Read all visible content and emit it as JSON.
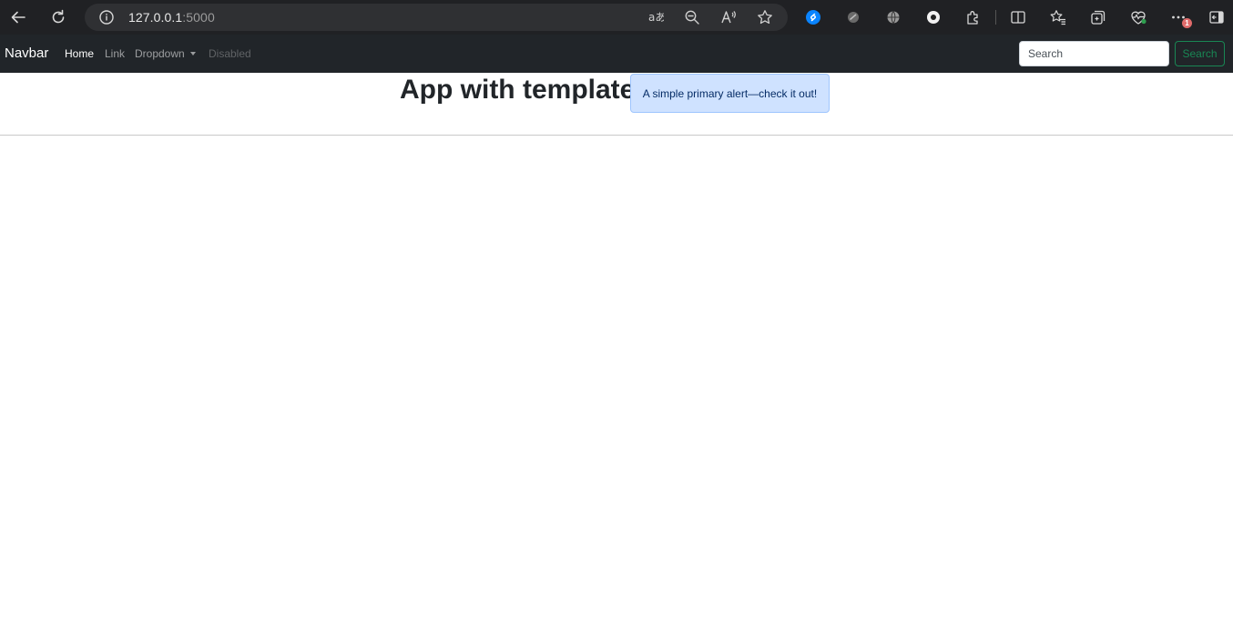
{
  "browser": {
    "url_host": "127.0.0.1",
    "url_port": ":5000",
    "notification_count": "1"
  },
  "navbar": {
    "brand": "Navbar",
    "items": [
      {
        "label": "Home",
        "state": "active"
      },
      {
        "label": "Link",
        "state": "normal"
      },
      {
        "label": "Dropdown",
        "state": "dropdown"
      },
      {
        "label": "Disabled",
        "state": "disabled"
      }
    ],
    "search": {
      "placeholder": "Search",
      "value": "",
      "button_label": "Search"
    }
  },
  "main": {
    "title": "App with template",
    "alert_text": "A simple primary alert—check it out!"
  },
  "colors": {
    "navbar_bg": "#212529",
    "alert_bg": "#cfe2ff",
    "success_outline": "#198754"
  },
  "icons": [
    "back-icon",
    "refresh-icon",
    "info-icon",
    "translate-icon",
    "zoom-out-icon",
    "read-aloud-icon",
    "favorite-star-icon",
    "shazam-icon",
    "extension-icon",
    "globe-icon",
    "eye-icon",
    "puzzle-icon",
    "split-screen-icon",
    "favorites-icon",
    "collections-icon",
    "health-icon",
    "more-icon",
    "sidebar-icon"
  ]
}
